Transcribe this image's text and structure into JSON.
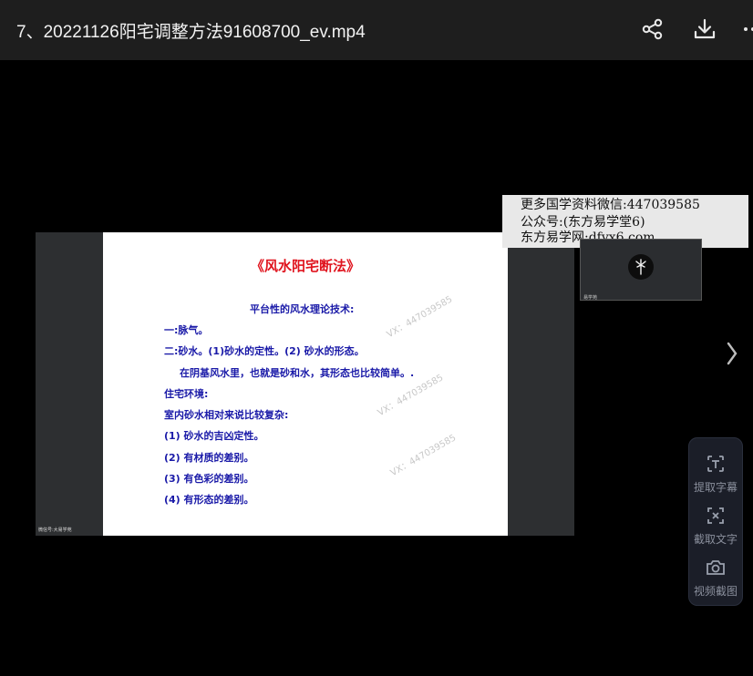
{
  "header": {
    "title": "7、20221126阳宅调整方法91608700_ev.mp4",
    "icons": [
      "share-icon",
      "download-icon",
      "more-icon"
    ]
  },
  "video": {
    "slide": {
      "title": "《风水阳宅断法》",
      "lines": [
        "平台性的风水理论技术:",
        "一:脉气。",
        "二:砂水。(1)砂水的定性。(2)  砂水的形态。",
        "在阴基风水里，也就是砂和水，其形态也比较简单。.",
        "住宅环境:",
        "室内砂水相对来说比较复杂:",
        "(1) 砂水的吉凶定性。",
        "(2) 有材质的差别。",
        "(3) 有色彩的差别。",
        "(4) 有形态的差别。"
      ],
      "watermark": "VX：447039585"
    },
    "camera_label": "微信号:大易学苑",
    "overlay_lines": [
      "更多国学资料微信:447039585",
      "公众号:(东方易学堂6)",
      "东方易学网:dfyx6.com"
    ],
    "thumbnail_label": "易学苑"
  },
  "toolbox": {
    "items": [
      {
        "label": "提取字幕",
        "icon": "extract-subtitle-icon"
      },
      {
        "label": "截取文字",
        "icon": "capture-text-icon"
      },
      {
        "label": "视频截图",
        "icon": "screenshot-camera-icon"
      }
    ]
  },
  "colors": {
    "topbar": "#1e1e1e",
    "slide_title": "#e0141e",
    "slide_text": "#1a1aa8",
    "toolbox_bg": "#1b1e28"
  }
}
